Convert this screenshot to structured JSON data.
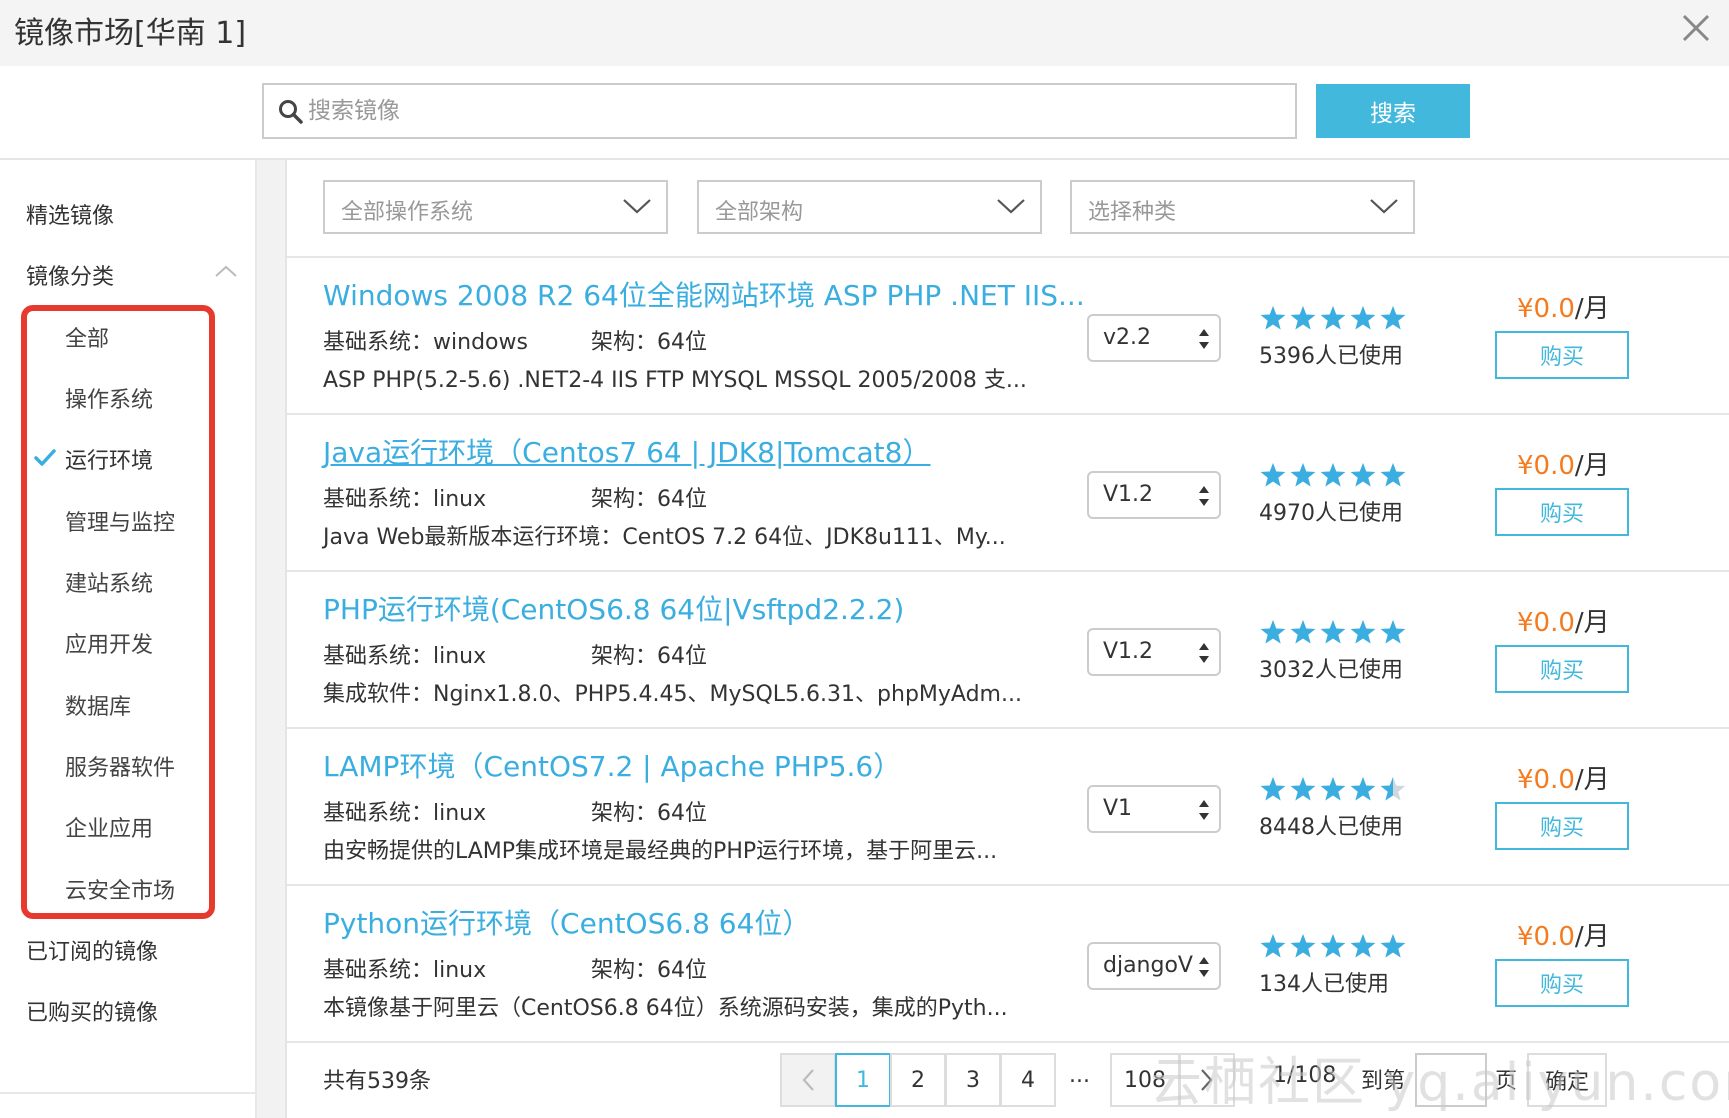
{
  "header": {
    "title": "镜像市场[华南 1]"
  },
  "search": {
    "placeholder": "搜索镜像",
    "button": "搜索"
  },
  "sidebar": {
    "featured": "精选镜像",
    "category": "镜像分类",
    "subitems": [
      "全部",
      "操作系统",
      "运行环境",
      "管理与监控",
      "建站系统",
      "应用开发",
      "数据库",
      "服务器软件",
      "企业应用",
      "云安全市场"
    ],
    "active_subitem": "运行环境",
    "subscribed": "已订阅的镜像",
    "purchased": "已购买的镜像"
  },
  "filters": {
    "os": "全部操作系统",
    "arch": "全部架构",
    "type": "选择种类"
  },
  "labels": {
    "base_prefix": "基础系统：",
    "arch_prefix": "架构：",
    "buy": "购买",
    "users_suffix": "人已使用",
    "unit": "/月"
  },
  "items": [
    {
      "title": "Windows 2008 R2 64位全能网站环境 ASP PHP .NET IIS...",
      "base": "windows",
      "arch": "64位",
      "desc": "ASP PHP(5.2-5.6) .NET2-4 IIS FTP MYSQL MSSQL 2005/2008 支...",
      "version": "v2.2",
      "users": "5396",
      "rating": 5,
      "price": "¥0.0"
    },
    {
      "title": "Java运行环境（Centos7 64 | JDK8|Tomcat8）",
      "base": "linux",
      "arch": "64位",
      "desc": "Java Web最新版本运行环境：CentOS 7.2 64位、JDK8u111、My...",
      "version": "V1.2",
      "users": "4970",
      "rating": 5,
      "price": "¥0.0"
    },
    {
      "title": "PHP运行环境(CentOS6.8 64位|Vsftpd2.2.2)",
      "base": "linux",
      "arch": "64位",
      "desc": "集成软件：Nginx1.8.0、PHP5.4.45、MySQL5.6.31、phpMyAdm...",
      "version": "V1.2",
      "users": "3032",
      "rating": 5,
      "price": "¥0.0"
    },
    {
      "title": "LAMP环境（CentOS7.2 | Apache PHP5.6）",
      "base": "linux",
      "arch": "64位",
      "desc": "由安畅提供的LAMP集成环境是最经典的PHP运行环境，基于阿里云...",
      "version": "V1",
      "users": "8448",
      "rating": 4.5,
      "price": "¥0.0"
    },
    {
      "title": "Python运行环境（CentOS6.8 64位）",
      "base": "linux",
      "arch": "64位",
      "desc": "本镜像基于阿里云（CentOS6.8 64位）系统源码安装，集成的Pyth...",
      "version": "djangoV",
      "users": "134",
      "rating": 5,
      "price": "¥0.0"
    }
  ],
  "pagination": {
    "total": "共有539条",
    "pages": [
      "1",
      "2",
      "3",
      "4"
    ],
    "ellipsis": "...",
    "last": "108",
    "current_of_total": "1/108",
    "goto_label": "到第",
    "page_label": "页",
    "confirm": "确定"
  },
  "watermark": "云栖社区 yq.aliyun.com",
  "colors": {
    "accent": "#42b8dd",
    "title_link": "#3aaee0",
    "price": "#f57b1f",
    "highlight_border": "#e8392f"
  }
}
